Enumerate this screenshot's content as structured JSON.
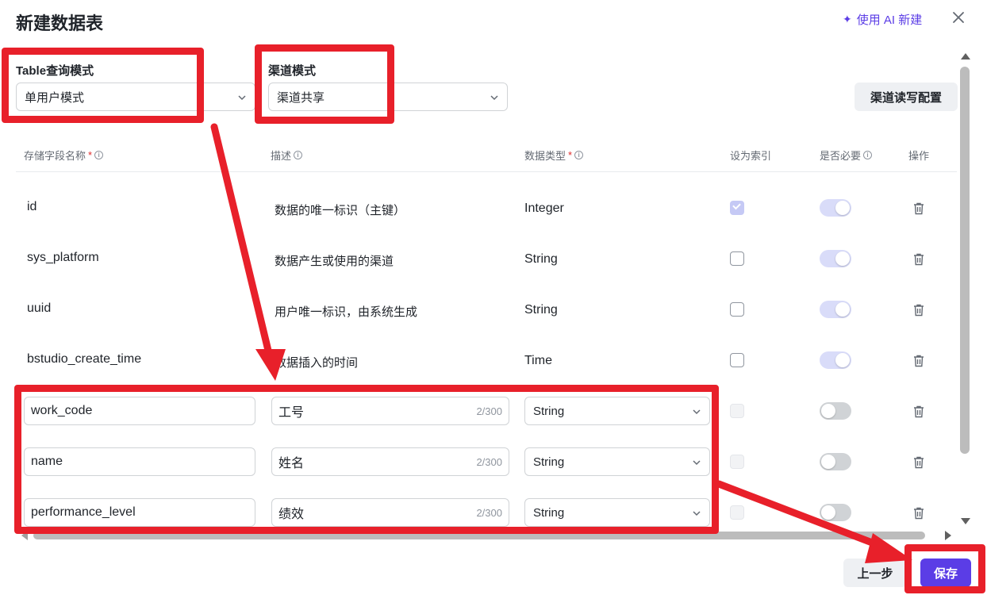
{
  "dialog": {
    "title": "新建数据表",
    "ai_button": "使用 AI 新建"
  },
  "settings": {
    "query_mode_label": "Table查询模式",
    "query_mode_value": "单用户模式",
    "channel_mode_label": "渠道模式",
    "channel_mode_value": "渠道共享",
    "channel_config_button": "渠道读写配置"
  },
  "table": {
    "headers": {
      "field_name": "存储字段名称",
      "description": "描述",
      "data_type": "数据类型",
      "is_index": "设为索引",
      "required": "是否必要",
      "actions": "操作"
    },
    "required_mark": "*",
    "fixed_rows": [
      {
        "name": "id",
        "desc": "数据的唯一标识（主键）",
        "type": "Integer",
        "index_checked": true,
        "required_on": true
      },
      {
        "name": "sys_platform",
        "desc": "数据产生或使用的渠道",
        "type": "String",
        "index_checked": false,
        "required_on": true
      },
      {
        "name": "uuid",
        "desc": "用户唯一标识，由系统生成",
        "type": "String",
        "index_checked": false,
        "required_on": true
      },
      {
        "name": "bstudio_create_time",
        "desc": "数据插入的时间",
        "type": "Time",
        "index_checked": false,
        "required_on": true
      }
    ],
    "editable_rows": [
      {
        "name": "work_code",
        "desc": "工号",
        "desc_count": "2/300",
        "type": "String"
      },
      {
        "name": "name",
        "desc": "姓名",
        "desc_count": "2/300",
        "type": "String"
      },
      {
        "name": "performance_level",
        "desc": "绩效",
        "desc_count": "2/300",
        "type": "String"
      }
    ]
  },
  "footer": {
    "prev_button": "上一步",
    "save_button": "保存"
  },
  "colors": {
    "accent": "#5b3de6",
    "annotation": "#e8202a"
  }
}
